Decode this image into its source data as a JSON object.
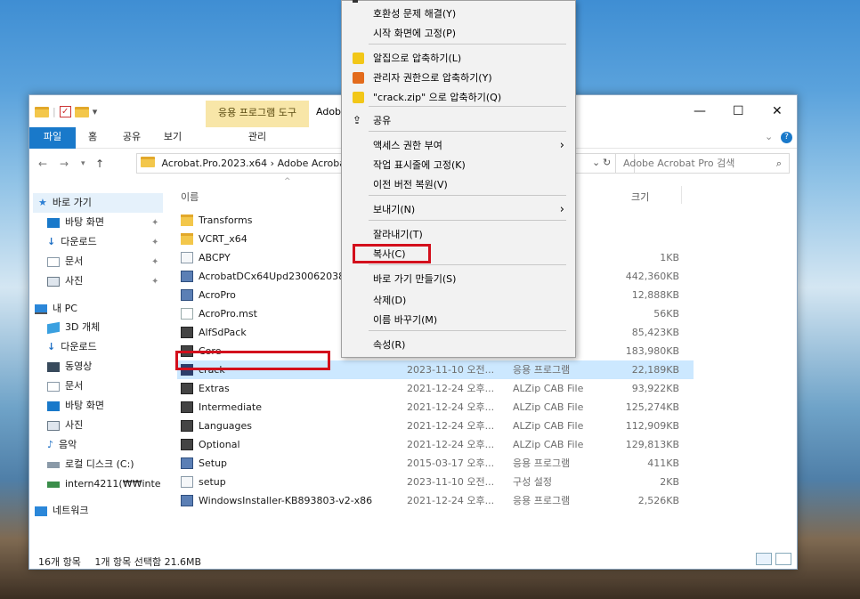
{
  "window": {
    "context_tools": "응용 프로그램 도구",
    "title": "Adob",
    "controls": {
      "minimize": "—",
      "maximize": "☐",
      "close": "✕"
    }
  },
  "ribbon": {
    "tabs": [
      "파일",
      "홈",
      "공유",
      "보기"
    ],
    "context_tab": "관리"
  },
  "address": {
    "path": "Acrobat.Pro.2023.x64  ›  Adobe Acroba",
    "search_placeholder": "Adobe Acrobat Pro 검색"
  },
  "columns": {
    "name": "이름",
    "size": "크기"
  },
  "nav": {
    "quick_access": "바로 가기",
    "items": [
      {
        "label": "바탕 화면",
        "icon": "desktop-icon",
        "pinned": true
      },
      {
        "label": "다운로드",
        "icon": "download-icon",
        "pinned": true
      },
      {
        "label": "문서",
        "icon": "document-icon",
        "pinned": true
      },
      {
        "label": "사진",
        "icon": "pictures-icon",
        "pinned": true
      }
    ],
    "this_pc": "내 PC",
    "pc_items": [
      {
        "label": "3D 개체",
        "icon": "3d-objects-icon"
      },
      {
        "label": "다운로드",
        "icon": "download-icon"
      },
      {
        "label": "동영상",
        "icon": "video-icon"
      },
      {
        "label": "문서",
        "icon": "document-icon"
      },
      {
        "label": "바탕 화면",
        "icon": "desktop-icon"
      },
      {
        "label": "사진",
        "icon": "pictures-icon"
      },
      {
        "label": "음악",
        "icon": "music-icon"
      },
      {
        "label": "로컬 디스크 (C:)",
        "icon": "drive-icon"
      },
      {
        "label": "intern4211(₩₩inte",
        "icon": "network-drive-icon"
      }
    ],
    "network": "네트워크"
  },
  "files": [
    {
      "name": "Transforms",
      "date": "",
      "type": "",
      "size": "",
      "icon": "folder-icon"
    },
    {
      "name": "VCRT_x64",
      "date": "",
      "type": "",
      "size": "",
      "icon": "folder-icon"
    },
    {
      "name": "ABCPY",
      "date": "",
      "type": "",
      "size": "1KB",
      "icon": "settings-file-icon"
    },
    {
      "name": "AcrobatDCx64Upd230062038",
      "date": "",
      "type": "aller",
      "size": "442,360KB",
      "icon": "installer-icon"
    },
    {
      "name": "AcroPro",
      "date": "",
      "type": "aller...",
      "size": "12,888KB",
      "icon": "installer-icon"
    },
    {
      "name": "AcroPro.mst",
      "date": "",
      "type": "",
      "size": "56KB",
      "icon": "file-icon"
    },
    {
      "name": "AlfSdPack",
      "date": "",
      "type": "le",
      "size": "85,423KB",
      "icon": "cab-icon"
    },
    {
      "name": "Core",
      "date": "",
      "type": "le",
      "size": "183,980KB",
      "icon": "cab-icon"
    },
    {
      "name": "crack",
      "date": "2023-11-10 오전...",
      "type": "응용 프로그램",
      "size": "22,189KB",
      "icon": "acrobat-icon"
    },
    {
      "name": "Extras",
      "date": "2021-12-24 오후...",
      "type": "ALZip CAB File",
      "size": "93,922KB",
      "icon": "cab-icon"
    },
    {
      "name": "Intermediate",
      "date": "2021-12-24 오후...",
      "type": "ALZip CAB File",
      "size": "125,274KB",
      "icon": "cab-icon"
    },
    {
      "name": "Languages",
      "date": "2021-12-24 오후...",
      "type": "ALZip CAB File",
      "size": "112,909KB",
      "icon": "cab-icon"
    },
    {
      "name": "Optional",
      "date": "2021-12-24 오후...",
      "type": "ALZip CAB File",
      "size": "129,813KB",
      "icon": "cab-icon"
    },
    {
      "name": "Setup",
      "date": "2015-03-17 오후...",
      "type": "응용 프로그램",
      "size": "411KB",
      "icon": "installer-icon"
    },
    {
      "name": "setup",
      "date": "2023-11-10 오전...",
      "type": "구성 설정",
      "size": "2KB",
      "icon": "settings-file-icon"
    },
    {
      "name": "WindowsInstaller-KB893803-v2-x86",
      "date": "2021-12-24 오후...",
      "type": "응용 프로그램",
      "size": "2,526KB",
      "icon": "installer-icon"
    }
  ],
  "status": {
    "count": "16개 항목",
    "selection": "1개 항목 선택함 21.6MB"
  },
  "context_menu": {
    "items": [
      {
        "label": "호환성 문제 해결(Y)"
      },
      {
        "label": "시작 화면에 고정(P)"
      },
      {
        "label": "알집으로 압축하기(L)",
        "icon": "alzip-icon"
      },
      {
        "label": "관리자 권한으로 압축하기(Y)",
        "icon": "admin-zip-icon"
      },
      {
        "label": "\"crack.zip\" 으로 압축하기(Q)",
        "icon": "alzip-icon"
      },
      {
        "label": "공유",
        "icon": "share-icon"
      },
      {
        "label": "액세스 권한 부여",
        "submenu": true
      },
      {
        "label": "작업 표시줄에 고정(K)"
      },
      {
        "label": "이전 버전 복원(V)"
      },
      {
        "label": "보내기(N)",
        "submenu": true
      },
      {
        "label": "잘라내기(T)"
      },
      {
        "label": "복사(C)"
      },
      {
        "label": "바로 가기 만들기(S)"
      },
      {
        "label": "삭제(D)"
      },
      {
        "label": "이름 바꾸기(M)"
      },
      {
        "label": "속성(R)"
      }
    ]
  },
  "colors": {
    "accent": "#1979ca",
    "selection": "#cce8ff",
    "highlight": "#d30f1c"
  }
}
